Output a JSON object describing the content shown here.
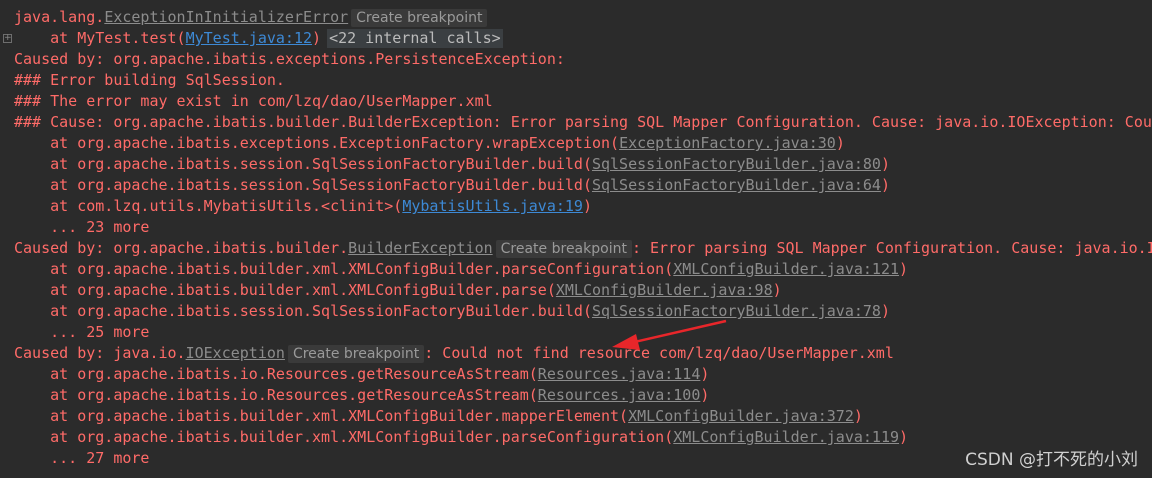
{
  "console": {
    "lines": [
      {
        "pre": "java.lang.",
        "link": "ExceptionInInitializerError",
        "link_style": "gray",
        "badge": "Create breakpoint",
        "post": ""
      },
      {
        "pre": "    at MyTest.test(",
        "link": "MyTest.java:12",
        "link_style": "blue",
        "post": ")",
        "calls": "<22 internal calls>",
        "fold": "+"
      },
      {
        "pre": "Caused by: org.apache.ibatis.exceptions.PersistenceException: "
      },
      {
        "pre": "### Error building SqlSession."
      },
      {
        "pre": "### The error may exist in com/lzq/dao/UserMapper.xml"
      },
      {
        "pre": "### Cause: org.apache.ibatis.builder.BuilderException: Error parsing SQL Mapper Configuration. Cause: java.io.IOException: Could not find resource com/lzq/dao/UserMapper.xml"
      },
      {
        "pre": "    at org.apache.ibatis.exceptions.ExceptionFactory.wrapException(",
        "link": "ExceptionFactory.java:30",
        "link_style": "gray",
        "post": ")"
      },
      {
        "pre": "    at org.apache.ibatis.session.SqlSessionFactoryBuilder.build(",
        "link": "SqlSessionFactoryBuilder.java:80",
        "link_style": "gray",
        "post": ")"
      },
      {
        "pre": "    at org.apache.ibatis.session.SqlSessionFactoryBuilder.build(",
        "link": "SqlSessionFactoryBuilder.java:64",
        "link_style": "gray",
        "post": ")"
      },
      {
        "pre": "    at com.lzq.utils.MybatisUtils.<clinit>(",
        "link": "MybatisUtils.java:19",
        "link_style": "blue",
        "post": ")"
      },
      {
        "pre": "    ... 23 more"
      },
      {
        "pre": "Caused by: org.apache.ibatis.builder.",
        "link": "BuilderException",
        "link_style": "gray",
        "badge": "Create breakpoint",
        "post": ": Error parsing SQL Mapper Configuration. Cause: java.io.IOException: Could not find resource com/lzq/dao/UserMapper.xml"
      },
      {
        "pre": "    at org.apache.ibatis.builder.xml.XMLConfigBuilder.parseConfiguration(",
        "link": "XMLConfigBuilder.java:121",
        "link_style": "gray",
        "post": ")"
      },
      {
        "pre": "    at org.apache.ibatis.builder.xml.XMLConfigBuilder.parse(",
        "link": "XMLConfigBuilder.java:98",
        "link_style": "gray",
        "post": ")"
      },
      {
        "pre": "    at org.apache.ibatis.session.SqlSessionFactoryBuilder.build(",
        "link": "SqlSessionFactoryBuilder.java:78",
        "link_style": "gray",
        "post": ")"
      },
      {
        "pre": "    ... 25 more"
      },
      {
        "pre": "Caused by: java.io.",
        "link": "IOException",
        "link_style": "gray",
        "badge": "Create breakpoint",
        "post": ": Could not find resource com/lzq/dao/UserMapper.xml"
      },
      {
        "pre": "    at org.apache.ibatis.io.Resources.getResourceAsStream(",
        "link": "Resources.java:114",
        "link_style": "gray",
        "post": ")"
      },
      {
        "pre": "    at org.apache.ibatis.io.Resources.getResourceAsStream(",
        "link": "Resources.java:100",
        "link_style": "gray",
        "post": ")"
      },
      {
        "pre": "    at org.apache.ibatis.builder.xml.XMLConfigBuilder.mapperElement(",
        "link": "XMLConfigBuilder.java:372",
        "link_style": "gray",
        "post": ")"
      },
      {
        "pre": "    at org.apache.ibatis.builder.xml.XMLConfigBuilder.parseConfiguration(",
        "link": "XMLConfigBuilder.java:119",
        "link_style": "gray",
        "post": ")"
      },
      {
        "pre": "    ... 27 more"
      }
    ]
  },
  "watermark": "CSDN @打不死的小刘",
  "colors": {
    "background": "#2b2b2b",
    "error_text": "#ff6b68",
    "link_blue": "#3d89d5",
    "link_gray": "#8c8c8c",
    "arrow": "#e8262a"
  }
}
